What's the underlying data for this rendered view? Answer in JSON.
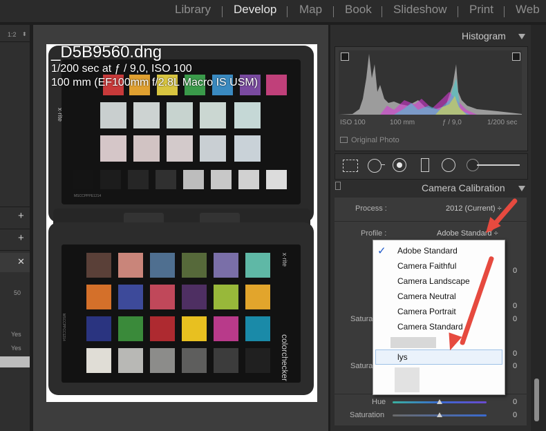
{
  "modules": [
    "Library",
    "Develop",
    "Map",
    "Book",
    "Slideshow",
    "Print",
    "Web"
  ],
  "active_module": "Develop",
  "left_panel": {
    "zoom_ratio": "1:2",
    "value_50": "50",
    "yes_1": "Yes",
    "yes_2": "Yes"
  },
  "photo_info": {
    "filename": "_D5B9560.dng",
    "exposure": "1/200 sec at ƒ / 9,0, ISO 100",
    "lens": "100 mm (EF100mm f/2.8L Macro IS USM)"
  },
  "card_text": {
    "brand": "x·rite",
    "serial_top": "MSCCPPPE1214",
    "serial_bottom": "MSCCPPCC1214",
    "colorchecker": "colorchecker"
  },
  "histogram": {
    "title": "Histogram",
    "iso": "ISO 100",
    "focal": "100 mm",
    "aperture": "ƒ / 9,0",
    "shutter": "1/200 sec",
    "original_photo": "Original Photo"
  },
  "camera_calibration": {
    "title": "Camera Calibration",
    "process_label": "Process :",
    "process_value": "2012 (Current) ÷",
    "profile_label": "Profile :",
    "profile_value": "Adobe Standard ÷",
    "saturation_label": "Saturation",
    "hue_label": "Hue",
    "zero": "0"
  },
  "profile_menu": {
    "checkmark": "✓",
    "options": [
      "Adobe Standard",
      "Camera Faithful",
      "Camera Landscape",
      "Camera Neutral",
      "Camera Portrait",
      "Camera Standard"
    ],
    "custom_option": "lys"
  },
  "colors": {
    "accent_arrow": "#e64a3f",
    "checkmark": "#1a56c8",
    "panel_bg": "#2d2d2d"
  }
}
